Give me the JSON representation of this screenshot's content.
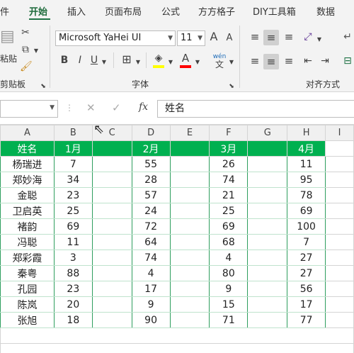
{
  "ribbon_tabs": [
    "件",
    "开始",
    "插入",
    "页面布局",
    "公式",
    "方方格子",
    "DIY工具箱",
    "数据"
  ],
  "active_tab_index": 1,
  "ribbon": {
    "font_name": "Microsoft YaHei UI",
    "font_size": "11",
    "groups": {
      "clipboard": "剪贴板",
      "font": "字体",
      "alignment": "对齐方式"
    },
    "paste_label": "粘贴",
    "bold": "B",
    "italic": "I",
    "underline": "U",
    "grow_font": "A",
    "shrink_font": "A",
    "font_color_glyph": "A",
    "phonetic_top": "wén",
    "phonetic_bottom": "文"
  },
  "formula_bar": {
    "fx": "fx",
    "value": "姓名",
    "cancel": "✕",
    "enter": "✓"
  },
  "columns": [
    "A",
    "B",
    "C",
    "D",
    "E",
    "F",
    "G",
    "H",
    "I"
  ],
  "table": {
    "headers": [
      "姓名",
      "1月",
      "",
      "2月",
      "",
      "3月",
      "",
      "4月"
    ],
    "rows": [
      [
        "杨瑞进",
        "7",
        "",
        "55",
        "",
        "26",
        "",
        "11"
      ],
      [
        "郑妙海",
        "34",
        "",
        "28",
        "",
        "74",
        "",
        "95"
      ],
      [
        "金聪",
        "23",
        "",
        "57",
        "",
        "21",
        "",
        "78"
      ],
      [
        "卫启英",
        "25",
        "",
        "24",
        "",
        "25",
        "",
        "69"
      ],
      [
        "褚韵",
        "69",
        "",
        "72",
        "",
        "69",
        "",
        "100"
      ],
      [
        "冯聪",
        "11",
        "",
        "64",
        "",
        "68",
        "",
        "7"
      ],
      [
        "郑彩霞",
        "3",
        "",
        "74",
        "",
        "4",
        "",
        "27"
      ],
      [
        "秦粤",
        "88",
        "",
        "4",
        "",
        "80",
        "",
        "27"
      ],
      [
        "孔园",
        "23",
        "",
        "17",
        "",
        "9",
        "",
        "56"
      ],
      [
        "陈岚",
        "20",
        "",
        "9",
        "",
        "15",
        "",
        "17"
      ],
      [
        "张旭",
        "18",
        "",
        "90",
        "",
        "71",
        "",
        "77"
      ]
    ]
  },
  "colors": {
    "header_fill": "#00b050",
    "accent": "#217346"
  }
}
